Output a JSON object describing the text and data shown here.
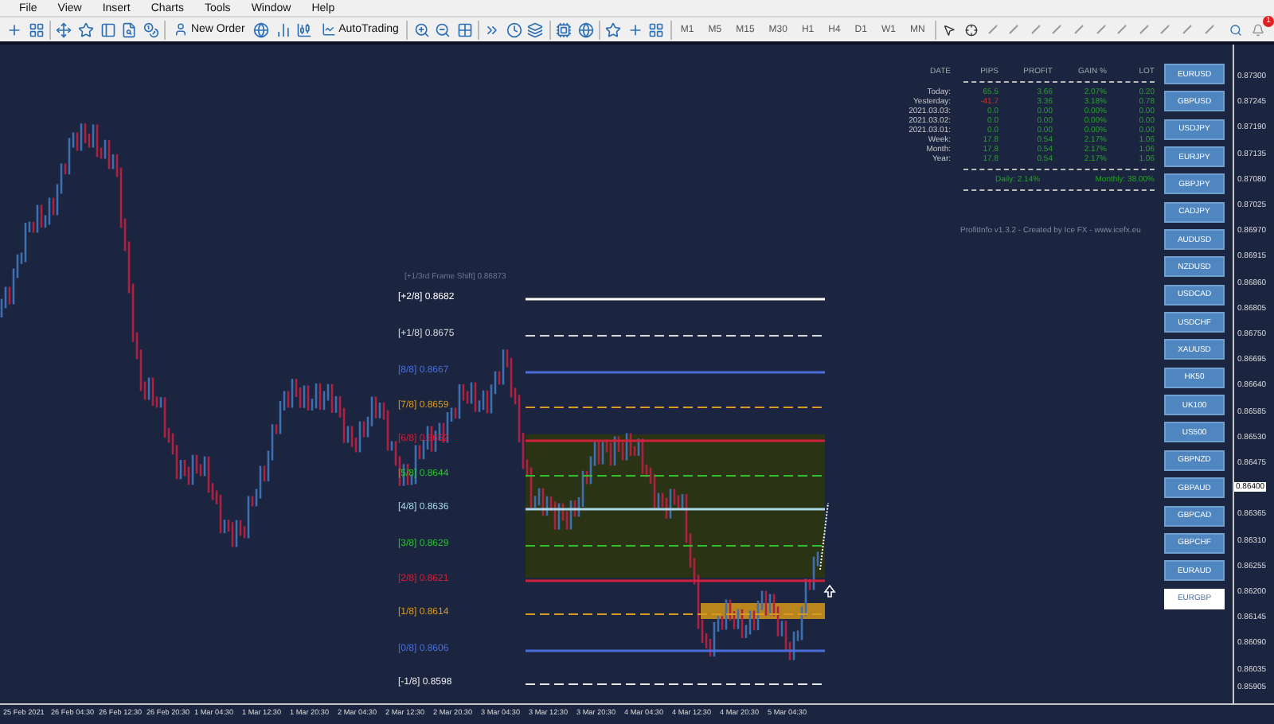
{
  "menu": [
    "File",
    "View",
    "Insert",
    "Charts",
    "Tools",
    "Window",
    "Help"
  ],
  "toolbar": [
    {
      "kind": "icon"
    },
    {
      "kind": "icon"
    },
    {
      "kind": "sep"
    },
    {
      "kind": "icon"
    },
    {
      "kind": "icon"
    },
    {
      "kind": "icon"
    },
    {
      "kind": "icon"
    },
    {
      "kind": "icon"
    },
    {
      "kind": "sep"
    },
    {
      "kind": "button",
      "label": "New Order"
    },
    {
      "kind": "icon"
    },
    {
      "kind": "icon"
    },
    {
      "kind": "icon"
    },
    {
      "kind": "button",
      "label": "AutoTrading"
    },
    {
      "kind": "sep"
    },
    {
      "kind": "icon"
    },
    {
      "kind": "icon"
    },
    {
      "kind": "icon"
    },
    {
      "kind": "sep"
    },
    {
      "kind": "icon"
    },
    {
      "kind": "icon"
    },
    {
      "kind": "icon"
    },
    {
      "kind": "sep"
    },
    {
      "kind": "icon"
    },
    {
      "kind": "icon"
    },
    {
      "kind": "sep"
    },
    {
      "kind": "icon"
    },
    {
      "kind": "icon"
    },
    {
      "kind": "icon"
    }
  ],
  "timeframes": [
    "M1",
    "M5",
    "M15",
    "M30",
    "H1",
    "H4",
    "D1",
    "W1",
    "MN"
  ],
  "notifications": "1",
  "stats": {
    "columns": [
      "DATE",
      "PIPS",
      "PROFIT",
      "GAIN %",
      "LOT"
    ],
    "rows": [
      {
        "date": "Today:",
        "pips": "65.5",
        "profit": "3.66",
        "gain": "2.07%",
        "lot": "0.20",
        "negative": false
      },
      {
        "date": "Yesterday:",
        "pips": "-41.7",
        "profit": "3.36",
        "gain": "3.18%",
        "lot": "0.78",
        "negative": true
      },
      {
        "date": "2021.03.03:",
        "pips": "0.0",
        "profit": "0.00",
        "gain": "0.00%",
        "lot": "0.00",
        "negative": false
      },
      {
        "date": "2021.03.02:",
        "pips": "0.0",
        "profit": "0.00",
        "gain": "0.00%",
        "lot": "0.00",
        "negative": false
      },
      {
        "date": "2021.03.01:",
        "pips": "0.0",
        "profit": "0.00",
        "gain": "0.00%",
        "lot": "0.00",
        "negative": false
      },
      {
        "date": "Week:",
        "pips": "17.8",
        "profit": "0.54",
        "gain": "2.17%",
        "lot": "1.06",
        "negative": false
      },
      {
        "date": "Month:",
        "pips": "17.8",
        "profit": "0.54",
        "gain": "2.17%",
        "lot": "1.06",
        "negative": false
      },
      {
        "date": "Year:",
        "pips": "17.8",
        "profit": "0.54",
        "gain": "2.17%",
        "lot": "1.06",
        "negative": false
      }
    ],
    "daily": "Daily: 2.14%",
    "monthly": "Monthly: 38.00%",
    "credit": "ProfitInfo v1.3.2 - Created by Ice FX - www.icefx.eu"
  },
  "symbols": [
    {
      "label": "EURUSD",
      "selected": false
    },
    {
      "label": "GBPUSD",
      "selected": false
    },
    {
      "label": "USDJPY",
      "selected": false
    },
    {
      "label": "EURJPY",
      "selected": false
    },
    {
      "label": "GBPJPY",
      "selected": false
    },
    {
      "label": "CADJPY",
      "selected": false
    },
    {
      "label": "AUDUSD",
      "selected": false
    },
    {
      "label": "NZDUSD",
      "selected": false
    },
    {
      "label": "USDCAD",
      "selected": false
    },
    {
      "label": "USDCHF",
      "selected": false
    },
    {
      "label": "XAUUSD",
      "selected": false
    },
    {
      "label": "HK50",
      "selected": false
    },
    {
      "label": "UK100",
      "selected": false
    },
    {
      "label": "US500",
      "selected": false
    },
    {
      "label": "GBPNZD",
      "selected": false
    },
    {
      "label": "GBPAUD",
      "selected": false
    },
    {
      "label": "GBPCAD",
      "selected": false
    },
    {
      "label": "GBPCHF",
      "selected": false
    },
    {
      "label": "EURAUD",
      "selected": false
    },
    {
      "label": "EURGBP",
      "selected": true
    }
  ],
  "frame_shift": "[+1/3rd Frame Shift]  0.86873",
  "levels": [
    {
      "label": "[+2/8]",
      "price": "0.8682",
      "color": "#ffffff"
    },
    {
      "label": "[+1/8]",
      "price": "0.8675",
      "color": "#d8d8d8"
    },
    {
      "label": "[8/8]",
      "price": "0.8667",
      "color": "#4a6fd8"
    },
    {
      "label": "[7/8]",
      "price": "0.8659",
      "color": "#d89a20"
    },
    {
      "label": "[6/8]",
      "price": "0.8652",
      "color": "#d0203a"
    },
    {
      "label": "[5/8]",
      "price": "0.8644",
      "color": "#30c030"
    },
    {
      "label": "[4/8]",
      "price": "0.8636",
      "color": "#a8d8e8"
    },
    {
      "label": "[3/8]",
      "price": "0.8629",
      "color": "#30c030"
    },
    {
      "label": "[2/8]",
      "price": "0.8621",
      "color": "#d0203a"
    },
    {
      "label": "[1/8]",
      "price": "0.8614",
      "color": "#d89a20"
    },
    {
      "label": "[0/8]",
      "price": "0.8606",
      "color": "#4a6fd8"
    },
    {
      "label": "[-1/8]",
      "price": "0.8598",
      "color": "#e8e8e8"
    }
  ],
  "price_axis": [
    "0.87300",
    "0.87245",
    "0.87190",
    "0.87135",
    "0.87080",
    "0.87025",
    "0.86970",
    "0.86915",
    "0.86860",
    "0.86805",
    "0.86750",
    "0.86695",
    "0.86640",
    "0.86585",
    "0.86530",
    "0.86475",
    "0.86365",
    "0.86310",
    "0.86255",
    "0.86200",
    "0.86145",
    "0.86090",
    "0.86035"
  ],
  "current_price": "0.86400",
  "bottom_price": "0.85905",
  "time_axis": [
    "25 Feb 2021",
    "26 Feb 04:30",
    "26 Feb 12:30",
    "26 Feb 20:30",
    "1 Mar 04:30",
    "1 Mar 12:30",
    "1 Mar 20:30",
    "2 Mar 04:30",
    "2 Mar 12:30",
    "2 Mar 20:30",
    "3 Mar 04:30",
    "3 Mar 12:30",
    "3 Mar 20:30",
    "4 Mar 04:30",
    "4 Mar 12:30",
    "4 Mar 20:30",
    "5 Mar 04:30"
  ]
}
